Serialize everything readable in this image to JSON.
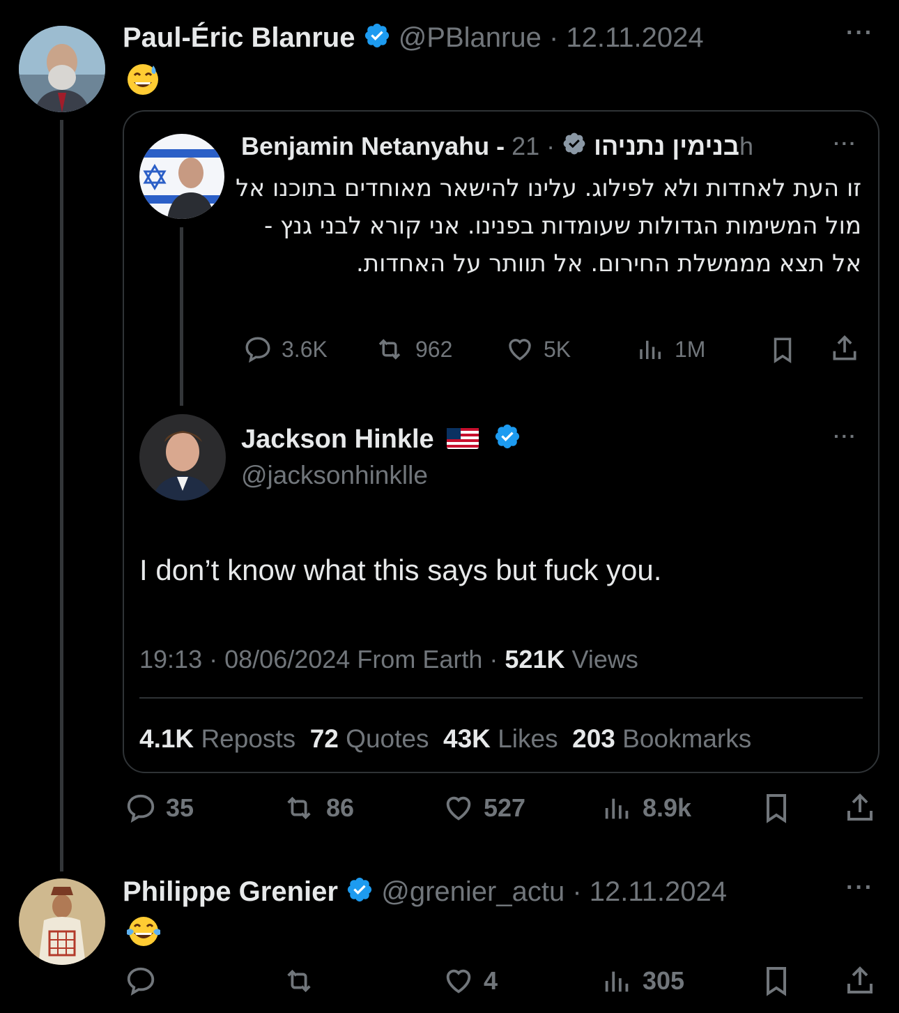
{
  "post1": {
    "name": "Paul-Éric Blanrue",
    "handle": "@PBlanrue",
    "sep": "·",
    "date": "12.11.2024",
    "body_emoji": "grinning-face-with-sweat",
    "stats": {
      "replies": "35",
      "reposts": "86",
      "likes": "527",
      "views": "8.9k"
    }
  },
  "quote": {
    "tweet1": {
      "name": "Benjamin Netanyahu - בנימין נתניהו",
      "sep": "·",
      "time": "21h",
      "text": "זו העת לאחדות ולא לפילוג. עלינו להישאר מאוחדים בתוכנו אל מול המשימות הגדולות שעומדות בפנינו. אני קורא לבני גנץ - אל תצא מממשלת החירום. אל תוותר על האחדות.",
      "stats": {
        "replies": "3.6K",
        "reposts": "962",
        "likes": "5K",
        "views": "1M"
      }
    },
    "tweet2": {
      "name": "Jackson Hinkle",
      "handle": "@jacksonhinklle",
      "text": "I don’t know what this says but fuck you.",
      "time": "19:13",
      "sep1": "·",
      "date": "08/06/2024",
      "source": "From Earth",
      "sep2": "·",
      "views_count": "521K",
      "views_label": "Views",
      "stats": {
        "reposts_count": "4.1K",
        "reposts_label": "Reposts",
        "quotes_count": "72",
        "quotes_label": "Quotes",
        "likes_count": "43K",
        "likes_label": "Likes",
        "bookmarks_count": "203",
        "bookmarks_label": "Bookmarks"
      }
    }
  },
  "post2": {
    "name": "Philippe Grenier",
    "handle": "@grenier_actu",
    "sep": "·",
    "date": "12.11.2024",
    "body_emoji": "face-with-tears-of-joy",
    "stats": {
      "replies": "",
      "reposts": "",
      "likes": "4",
      "views": "305"
    }
  },
  "colors": {
    "background": "#000000",
    "text": "#e7e9ea",
    "muted": "#71767b",
    "verified": "#1d9bf0",
    "border": "#2f3336"
  }
}
